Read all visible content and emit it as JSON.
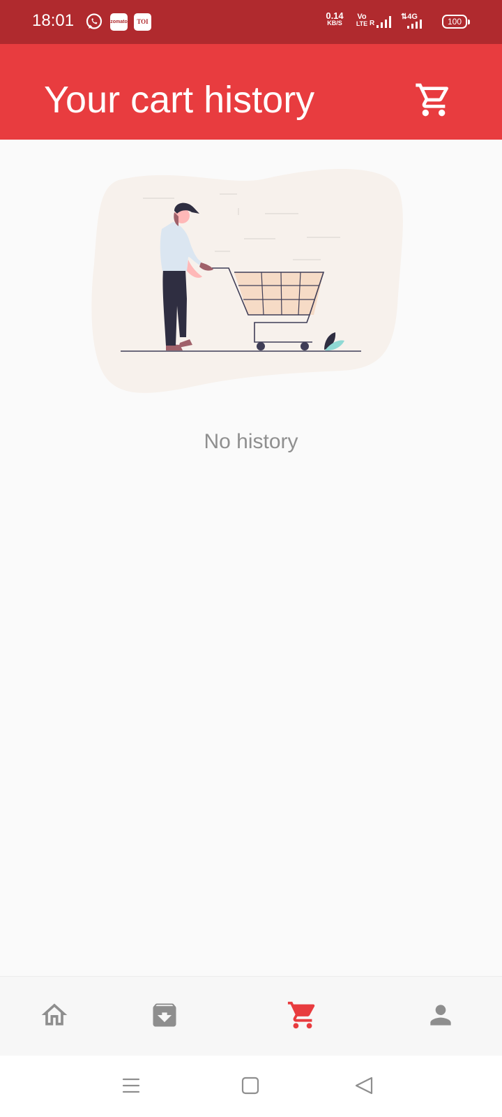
{
  "status_bar": {
    "time": "18:01",
    "notifications": [
      {
        "icon": "whatsapp-icon"
      },
      {
        "icon": "zomato-icon",
        "label": "zomato"
      },
      {
        "icon": "toi-icon",
        "label": "TOI"
      }
    ],
    "net_speed_value": "0.14",
    "net_speed_unit": "KB/S",
    "volte_line1": "Vo",
    "volte_line2": "LTE",
    "roaming": "R",
    "network_type": "4G",
    "battery": "100"
  },
  "app_bar": {
    "title": "Your cart history",
    "cart_icon": "cart-icon"
  },
  "empty_state": {
    "illustration": "shopping-cart-illustration",
    "message": "No history"
  },
  "bottom_nav": {
    "items": [
      {
        "name": "home",
        "icon": "home-icon",
        "active": false
      },
      {
        "name": "orders",
        "icon": "archive-download-icon",
        "active": false
      },
      {
        "name": "cart",
        "icon": "cart-icon",
        "active": true
      },
      {
        "name": "profile",
        "icon": "person-icon",
        "active": false
      }
    ],
    "active_color": "#e83c3f",
    "inactive_color": "#8e8e8e"
  },
  "colors": {
    "status_bar": "#b02a2e",
    "app_bar": "#e83c3f",
    "background": "#fafafa",
    "empty_text": "#8f8f8f"
  }
}
